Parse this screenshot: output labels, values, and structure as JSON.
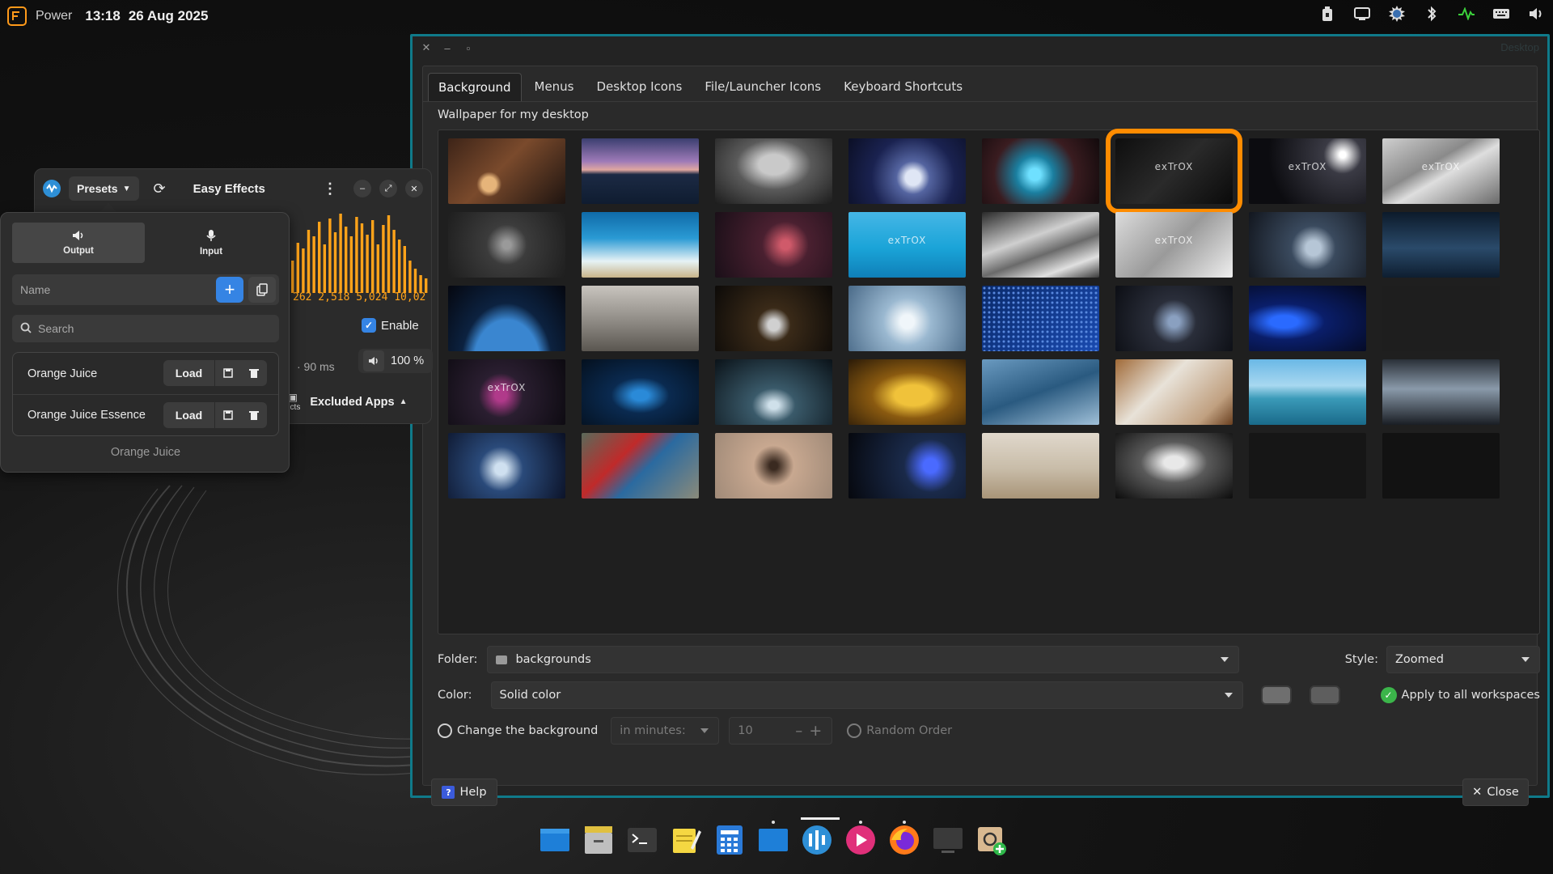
{
  "top_panel": {
    "menu_label": "Power",
    "time": "13:18",
    "date": "26 Aug 2025",
    "tray_icons": [
      "usb-drive-icon",
      "screen-icon",
      "weather-icon",
      "bluetooth-icon",
      "activity-monitor-icon",
      "keyboard-icon",
      "volume-icon"
    ]
  },
  "settings": {
    "window_title": "Desktop",
    "tabs": [
      "Background",
      "Menus",
      "Desktop Icons",
      "File/Launcher Icons",
      "Keyboard Shortcuts"
    ],
    "active_tab": "Background",
    "wallpaper_label": "Wallpaper for my desktop",
    "brand_text": "exTrOX",
    "folder_label": "Folder:",
    "folder_value": "backgrounds",
    "style_label": "Style:",
    "style_value": "Zoomed",
    "color_label": "Color:",
    "color_value": "Solid color",
    "apply_all_label": "Apply to all workspaces",
    "change_bg_label": "Change the background",
    "interval_unit": "in minutes:",
    "interval_value": "10",
    "random_order_label": "Random Order",
    "help_label": "Help",
    "close_label": "Close",
    "swatch_colors": [
      "#6f6f6f",
      "#5e5e5e"
    ],
    "selected_wallpaper_index": 5,
    "accent_color": "#ff8c00",
    "window_border_color": "#0f7a8a"
  },
  "easy_effects": {
    "presets_label": "Presets",
    "title": "Easy Effects",
    "spectrum_numbers": "262 2,518 5,024 10,02",
    "enable_label": "Enable",
    "latency": "· 90 ms",
    "volume": "100 %",
    "effects_tab_label": "ects",
    "excluded_apps_label": "Excluded Apps"
  },
  "presets_popover": {
    "output_label": "Output",
    "input_label": "Input",
    "name_placeholder": "Name",
    "search_placeholder": "Search",
    "presets": [
      {
        "name": "Orange Juice",
        "load_label": "Load"
      },
      {
        "name": "Orange Juice Essence",
        "load_label": "Load"
      }
    ],
    "current_preset": "Orange Juice"
  },
  "dock": {
    "apps": [
      "files-icon",
      "file-manager-icon",
      "terminal-icon",
      "text-editor-icon",
      "calculator-icon",
      "desktop-folder-icon",
      "easy-effects-icon",
      "media-player-icon",
      "firefox-icon",
      "screen-recorder-icon",
      "software-installer-icon"
    ]
  }
}
